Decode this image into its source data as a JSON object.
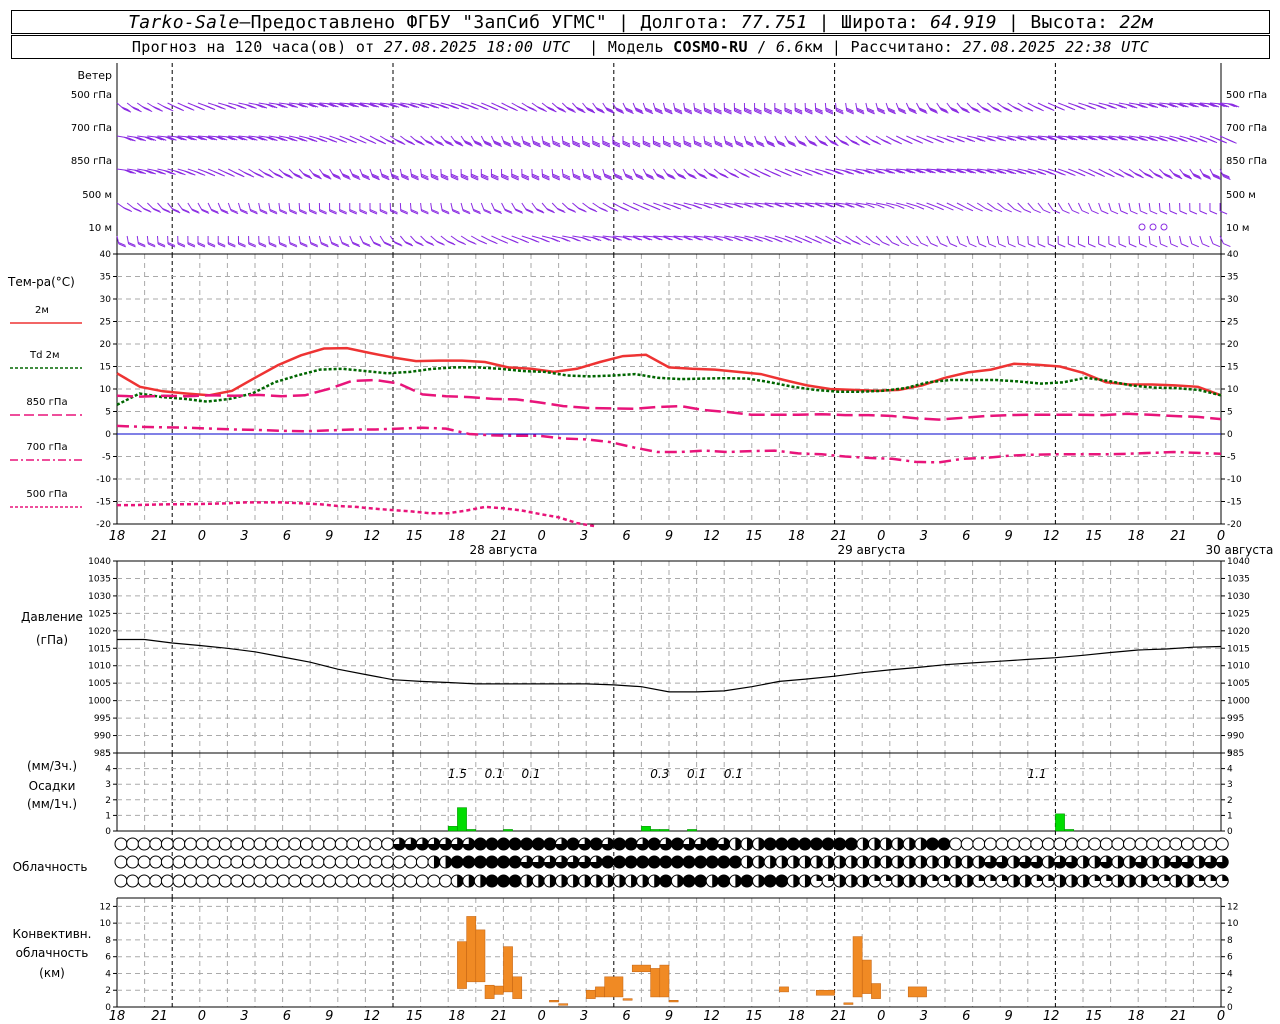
{
  "header": {
    "station": "Tarko-Sale",
    "dash": " – ",
    "provider": "Предоставлено ФГБУ \"ЗапСиб УГМС\"",
    "lon_label": "Долгота:",
    "lon": "77.751",
    "lat_label": "Широта:",
    "lat": "64.919",
    "alt_label": "Высота:",
    "alt": "22м",
    "forecast_prefix": "Прогноз на 120 часа(ов) от",
    "forecast_time": "27.08.2025 18:00 UTC",
    "model_label": "Модель",
    "model": "COSMO-RU",
    "resolution": "6.6",
    "resolution_unit": "км",
    "computed_label": "Рассчитано:",
    "computed_time": "27.08.2025 22:38 UTC"
  },
  "colors": {
    "t2m": "#ee3333",
    "td2m": "#006600",
    "t850": "#e8147a",
    "t700": "#e8147a",
    "t500": "#e8147a",
    "wind": "#8a2be2",
    "precip": "#00dd00",
    "convective": "#f08a24",
    "pressure": "#000000",
    "zero_line": "#0000cc"
  },
  "x_axis": {
    "hour_labels": [
      "18",
      "21",
      "0",
      "3",
      "6",
      "9",
      "12",
      "15",
      "18",
      "21",
      "0",
      "3",
      "6",
      "9",
      "12",
      "15",
      "18",
      "21",
      "0",
      "3",
      "6",
      "9",
      "12",
      "15",
      "18",
      "21",
      "0"
    ],
    "dates": [
      "28 августа",
      "29 августа",
      "30 августа"
    ]
  },
  "wind": {
    "title": "Ветер",
    "levels": [
      "500 гПа",
      "700 гПа",
      "850 гПа",
      "500 м",
      "10 м"
    ]
  },
  "temperature": {
    "title": "Тем-ра(°C)",
    "legend": [
      "2м",
      "Td 2м",
      "850 гПа",
      "700 гПа",
      "500 гПа"
    ],
    "ticks": [
      "40",
      "35",
      "30",
      "25",
      "20",
      "15",
      "10",
      "5",
      "0",
      "-5",
      "-10",
      "-15",
      "-20"
    ]
  },
  "pressure": {
    "title_line1": "Давление",
    "title_line2": "(гПа)",
    "ticks": [
      "1040",
      "1035",
      "1030",
      "1025",
      "1020",
      "1015",
      "1010",
      "1005",
      "1000",
      "995",
      "990",
      "985"
    ]
  },
  "precipitation": {
    "title_line1": "(мм/3ч.)",
    "title_line2": "Осадки",
    "title_line3": "(мм/1ч.)",
    "ticks": [
      "5",
      "4",
      "3",
      "2",
      "1",
      "0"
    ],
    "labels": [
      "1.5",
      "0.1",
      "0.1",
      "0.3",
      "0.1",
      "0.1",
      "1.1"
    ]
  },
  "clouds": {
    "title": "Облачность"
  },
  "convective": {
    "title_line1": "Конвективн.",
    "title_line2": "облачность",
    "title_line3": "(км)",
    "ticks": [
      "12",
      "10",
      "8",
      "6",
      "4",
      "2",
      "0"
    ]
  },
  "chart_data": [
    {
      "type": "line",
      "title": "Тем-ра(°C)",
      "ylim": [
        -20,
        40
      ],
      "x_hours": [
        0,
        3,
        6,
        9,
        12,
        15,
        18,
        21,
        24,
        27,
        30,
        33,
        36,
        39,
        42,
        45,
        48,
        51,
        54,
        57,
        60,
        63,
        66,
        69,
        72,
        75,
        78,
        81,
        84,
        87,
        90,
        93,
        96,
        99,
        102,
        105,
        108,
        111,
        114,
        117,
        120
      ],
      "series": [
        {
          "name": "2м",
          "values": [
            13.5,
            10.5,
            9.5,
            9.0,
            8.6,
            9.6,
            12.5,
            15.3,
            17.5,
            19.0,
            19.1,
            18.0,
            17.0,
            16.2,
            16.3,
            16.3,
            16.0,
            14.8,
            14.5,
            13.8,
            14.5,
            16.0,
            17.3,
            17.6,
            14.8,
            14.5,
            14.3,
            13.8,
            13.3,
            12.0,
            10.8,
            10.0,
            9.8,
            9.6,
            9.8,
            10.8,
            12.5,
            13.7,
            14.3,
            15.6,
            15.4,
            15.0,
            13.6,
            11.5,
            11.0,
            11.0,
            10.8,
            10.5,
            8.6
          ]
        },
        {
          "name": "Td 2м",
          "values": [
            6.5,
            9.0,
            8.2,
            7.8,
            7.2,
            7.8,
            9.0,
            11.5,
            13.0,
            14.3,
            14.5,
            14.0,
            13.5,
            13.8,
            14.5,
            14.8,
            14.8,
            14.5,
            14.0,
            13.8,
            13.0,
            12.8,
            13.0,
            13.3,
            12.5,
            12.2,
            12.3,
            12.4,
            12.3,
            11.5,
            10.5,
            9.8,
            9.4,
            9.4,
            9.6,
            10.2,
            11.5,
            12.0,
            12.0,
            12.0,
            11.7,
            11.2,
            11.5,
            12.5,
            11.8,
            10.8,
            10.3,
            10.2,
            9.8,
            8.6
          ]
        },
        {
          "name": "850 гПа",
          "values": [
            8.5,
            8.3,
            8.5,
            8.4,
            8.6,
            8.5,
            8.7,
            8.4,
            8.6,
            10.0,
            11.8,
            12.0,
            11.2,
            8.8,
            8.4,
            8.2,
            7.8,
            7.7,
            7.0,
            6.2,
            5.8,
            5.7,
            5.6,
            6.0,
            6.2,
            5.3,
            4.9,
            4.3,
            4.3,
            4.3,
            4.4,
            4.2,
            4.2,
            4.0,
            3.5,
            3.2,
            3.6,
            4.0,
            4.2,
            4.3,
            4.3,
            4.3,
            4.2,
            4.5,
            4.3,
            4.0,
            3.8,
            3.3
          ]
        },
        {
          "name": "700 гПа",
          "values": [
            1.8,
            1.6,
            1.5,
            1.4,
            1.2,
            1.0,
            0.9,
            0.7,
            0.6,
            0.8,
            1.0,
            1.0,
            1.2,
            1.4,
            1.2,
            0.0,
            -0.3,
            -0.4,
            -0.4,
            -1.0,
            -1.2,
            -1.8,
            -3.0,
            -4.0,
            -4.0,
            -3.7,
            -4.0,
            -3.8,
            -3.7,
            -4.3,
            -4.5,
            -5.0,
            -5.3,
            -5.5,
            -6.2,
            -6.3,
            -5.5,
            -5.3,
            -4.8,
            -4.6,
            -4.5,
            -4.5,
            -4.5,
            -4.4,
            -4.2,
            -4.0,
            -4.2,
            -4.4
          ]
        },
        {
          "name": "500 гПа",
          "values": [
            -15.8,
            -15.8,
            -15.7,
            -15.6,
            -15.6,
            -15.5,
            -15.4,
            -15.2,
            -15.2,
            -15.2,
            -15.4,
            -15.6,
            -16.0,
            -16.2,
            -16.6,
            -16.9,
            -17.2,
            -17.6,
            -17.6,
            -17.0,
            -16.2,
            -16.5,
            -17.0,
            -17.8,
            -18.5,
            -19.8,
            -20.5
          ]
        }
      ]
    },
    {
      "type": "line",
      "title": "Давление",
      "ylabel": "(гПа)",
      "ylim": [
        985,
        1040
      ],
      "x_hours": [
        0,
        3,
        6,
        9,
        12,
        15,
        18,
        21,
        24,
        27,
        30,
        33,
        36,
        39,
        42,
        45,
        48,
        51,
        54,
        57,
        60,
        63,
        66,
        69,
        72,
        75,
        78,
        81,
        84,
        87,
        90,
        93,
        96,
        99,
        102,
        105,
        108,
        111,
        114,
        117,
        120
      ],
      "series": [
        {
          "name": "",
          "values": [
            1017.5,
            1017.5,
            1016.5,
            1015.8,
            1015,
            1014,
            1012.5,
            1011,
            1009,
            1007.5,
            1006,
            1005.5,
            1005.2,
            1004.8,
            1004.8,
            1004.8,
            1004.8,
            1004.8,
            1004.5,
            1004,
            1002.5,
            1002.5,
            1002.8,
            1004,
            1005.5,
            1006.2,
            1007,
            1008,
            1008.8,
            1009.5,
            1010.3,
            1010.8,
            1011.3,
            1011.8,
            1012.3,
            1013,
            1013.8,
            1014.5,
            1014.8,
            1015.3,
            1015.5
          ]
        }
      ]
    },
    {
      "type": "bar",
      "title": "Осадки",
      "ylim": [
        0,
        5
      ],
      "x_hours": [
        39,
        42,
        45,
        48,
        51,
        54,
        57,
        60,
        63,
        66,
        69,
        72,
        75,
        78,
        81,
        84,
        87,
        90,
        93,
        96,
        99,
        102,
        105,
        108,
        111,
        114,
        117,
        120
      ],
      "bars_1h": [
        {
          "hour": 37,
          "value": 0.3
        },
        {
          "hour": 38,
          "value": 1.5
        },
        {
          "hour": 39,
          "value": 0.1
        },
        {
          "hour": 43,
          "value": 0.1
        },
        {
          "hour": 58,
          "value": 0.3
        },
        {
          "hour": 59,
          "value": 0.1
        },
        {
          "hour": 60,
          "value": 0.1
        },
        {
          "hour": 63,
          "value": 0.1
        },
        {
          "hour": 103,
          "value": 1.1
        },
        {
          "hour": 104,
          "value": 0.1
        }
      ]
    },
    {
      "type": "bar",
      "title": "Конвективн. облачность",
      "ylabel": "(км)",
      "ylim": [
        0,
        13
      ],
      "cloud_layers": [
        {
          "h0": 37,
          "h1": 38,
          "base": 2.2,
          "top": 7.8
        },
        {
          "h0": 38,
          "h1": 39,
          "base": 3.0,
          "top": 10.8
        },
        {
          "h0": 39,
          "h1": 40,
          "base": 3.0,
          "top": 9.2
        },
        {
          "h0": 40,
          "h1": 41,
          "base": 1.0,
          "top": 2.6
        },
        {
          "h0": 41,
          "h1": 42,
          "base": 1.5,
          "top": 2.5
        },
        {
          "h0": 42,
          "h1": 43,
          "base": 1.8,
          "top": 7.2
        },
        {
          "h0": 43,
          "h1": 44,
          "base": 1.0,
          "top": 3.6
        },
        {
          "h0": 47,
          "h1": 48,
          "base": 0.6,
          "top": 0.8
        },
        {
          "h0": 48,
          "h1": 49,
          "base": 0.2,
          "top": 0.4
        },
        {
          "h0": 51,
          "h1": 52,
          "base": 1.0,
          "top": 2.0
        },
        {
          "h0": 52,
          "h1": 53,
          "base": 1.2,
          "top": 2.4
        },
        {
          "h0": 53,
          "h1": 55,
          "base": 1.2,
          "top": 3.6
        },
        {
          "h0": 55,
          "h1": 56,
          "base": 0.8,
          "top": 1.0
        },
        {
          "h0": 56,
          "h1": 58,
          "base": 4.2,
          "top": 5.0
        },
        {
          "h0": 58,
          "h1": 59,
          "base": 1.2,
          "top": 4.6
        },
        {
          "h0": 59,
          "h1": 60,
          "base": 1.2,
          "top": 5.0
        },
        {
          "h0": 60,
          "h1": 61,
          "base": 0.6,
          "top": 0.8
        },
        {
          "h0": 72,
          "h1": 73,
          "base": 1.8,
          "top": 2.4
        },
        {
          "h0": 76,
          "h1": 78,
          "base": 1.4,
          "top": 2.0
        },
        {
          "h0": 79,
          "h1": 80,
          "base": 0.3,
          "top": 0.5
        },
        {
          "h0": 80,
          "h1": 81,
          "base": 1.2,
          "top": 8.4
        },
        {
          "h0": 81,
          "h1": 82,
          "base": 1.6,
          "top": 5.6
        },
        {
          "h0": 82,
          "h1": 83,
          "base": 1.0,
          "top": 2.8
        },
        {
          "h0": 86,
          "h1": 88,
          "base": 1.2,
          "top": 2.4
        }
      ]
    }
  ]
}
